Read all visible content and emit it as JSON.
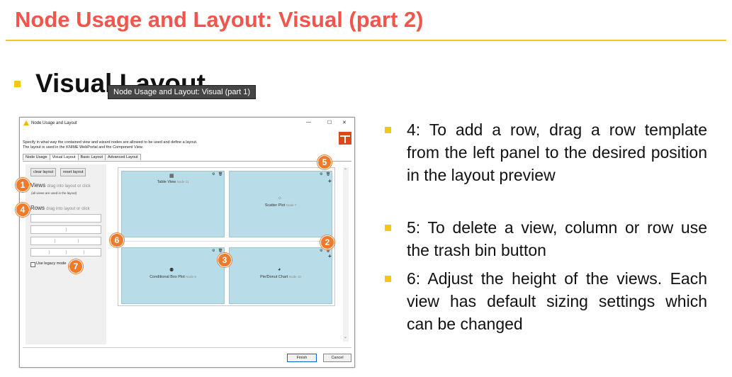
{
  "slide": {
    "title": "Node Usage and Layout: Visual (part 2)",
    "heading": "Visual Layout",
    "tooltip": "Node Usage and Layout: Visual (part 1)",
    "bullets": [
      "4: To add a row, drag a row template  from the left panel to the desired position in the layout preview",
      "5: To delete a view, column or row use the trash bin button",
      "6: Adjust the height of the views. Each view has default sizing settings which can be changed"
    ],
    "accent_color": "#f2554b",
    "rule_color": "#f5c518"
  },
  "dialog": {
    "title": "Node Usage and Layout",
    "description_line1": "Specify in what way the contained view and wizard nodes are allowed to be used and define a layout.",
    "description_line2": "The layout is used in the KNIME WebPortal and the Component View.",
    "tabs": [
      "Node Usage",
      "Visual Layout",
      "Basic Layout",
      "Advanced Layout"
    ],
    "active_tab": "Visual Layout",
    "clear_button": "clear layout",
    "reset_button": "reset layout",
    "views_label": "Views",
    "views_hint": "drag into layout or click",
    "views_note": "(all views are used in the layout)",
    "rows_label": "Rows",
    "rows_hint": "drag into layout or click",
    "legacy_label": "Use legacy mode",
    "finish_button": "Finish",
    "cancel_button": "Cancel",
    "views": [
      {
        "name": "Table View",
        "node": "Node 11",
        "icon": "table-icon"
      },
      {
        "name": "Scatter Plot",
        "node": "Node 7",
        "icon": "scatter-icon"
      },
      {
        "name": "Conditional Box Plot",
        "node": "Node 9",
        "icon": "boxplot-icon"
      },
      {
        "name": "Pie/Donut Chart",
        "node": "Node 10",
        "icon": "pie-icon"
      }
    ]
  },
  "badges": [
    "1",
    "4",
    "7",
    "5",
    "6",
    "2",
    "3"
  ]
}
